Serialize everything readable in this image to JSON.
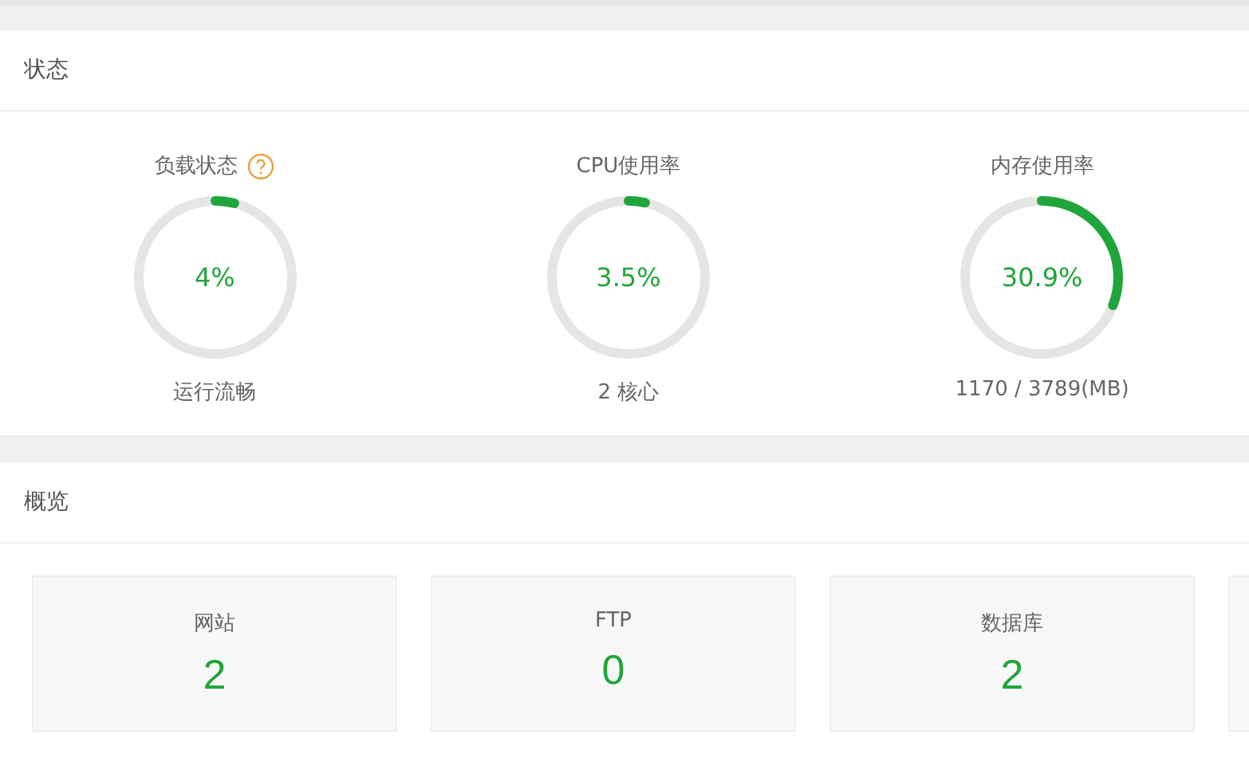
{
  "status": {
    "title": "状态",
    "gauges": [
      {
        "label": "负载状态",
        "help_icon": true,
        "level": 0.04,
        "value": "4%",
        "caption": "运行流畅"
      },
      {
        "label": "CPU使用率",
        "help_icon": false,
        "level": 0.035,
        "value": "3.5%",
        "caption": "2 核心"
      },
      {
        "label": "内存使用率",
        "help_icon": false,
        "level": 0.309,
        "value": "30.9%",
        "caption": "1170 / 3789(MB)"
      }
    ]
  },
  "overview": {
    "title": "概览",
    "cards": [
      {
        "label": "网站",
        "value": "2"
      },
      {
        "label": "FTP",
        "value": "0"
      },
      {
        "label": "数据库",
        "value": "2"
      }
    ]
  }
}
